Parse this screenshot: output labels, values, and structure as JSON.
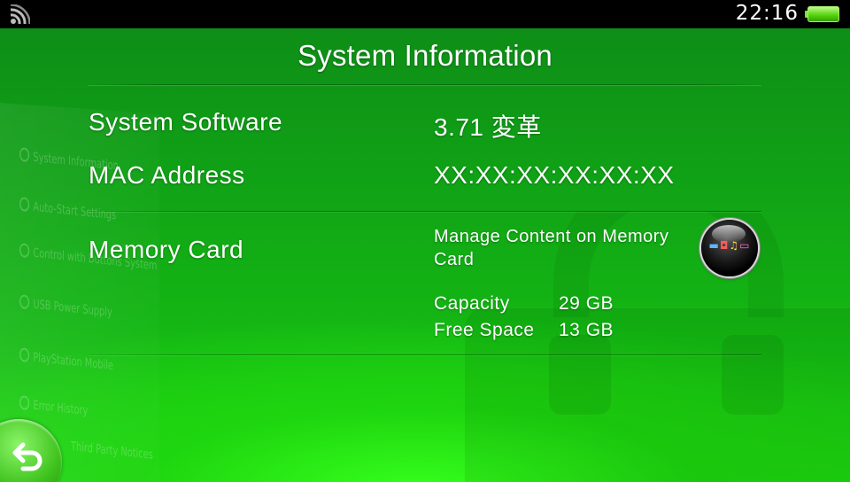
{
  "status_bar": {
    "time": "22:16",
    "wifi_icon": "wifi-icon",
    "battery_icon": "battery-icon"
  },
  "page": {
    "title": "System Information"
  },
  "rows": {
    "software": {
      "label": "System Software",
      "value": "3.71 変革"
    },
    "mac": {
      "label": "MAC Address",
      "value": "XX:XX:XX:XX:XX:XX"
    },
    "memory": {
      "label": "Memory Card",
      "manage_link": "Manage Content on Memory Card",
      "capacity_label": "Capacity",
      "capacity_value": "29 GB",
      "free_label": "Free Space",
      "free_value": "13 GB"
    }
  },
  "background_menu": [
    "System Information",
    "Auto-Start Settings",
    "Control with Buttons System",
    "USB Power Supply",
    "PlayStation Mobile",
    "Error History",
    "Third Party Notices"
  ],
  "icons": {
    "back": "back-arrow-icon",
    "content_manager": "content-manager-icon",
    "watermark": "lock-icon"
  },
  "colors": {
    "background_top": "#0e8e17",
    "background_bottom": "#1fd812",
    "status_bar": "#000000",
    "battery": "#58d40e"
  }
}
